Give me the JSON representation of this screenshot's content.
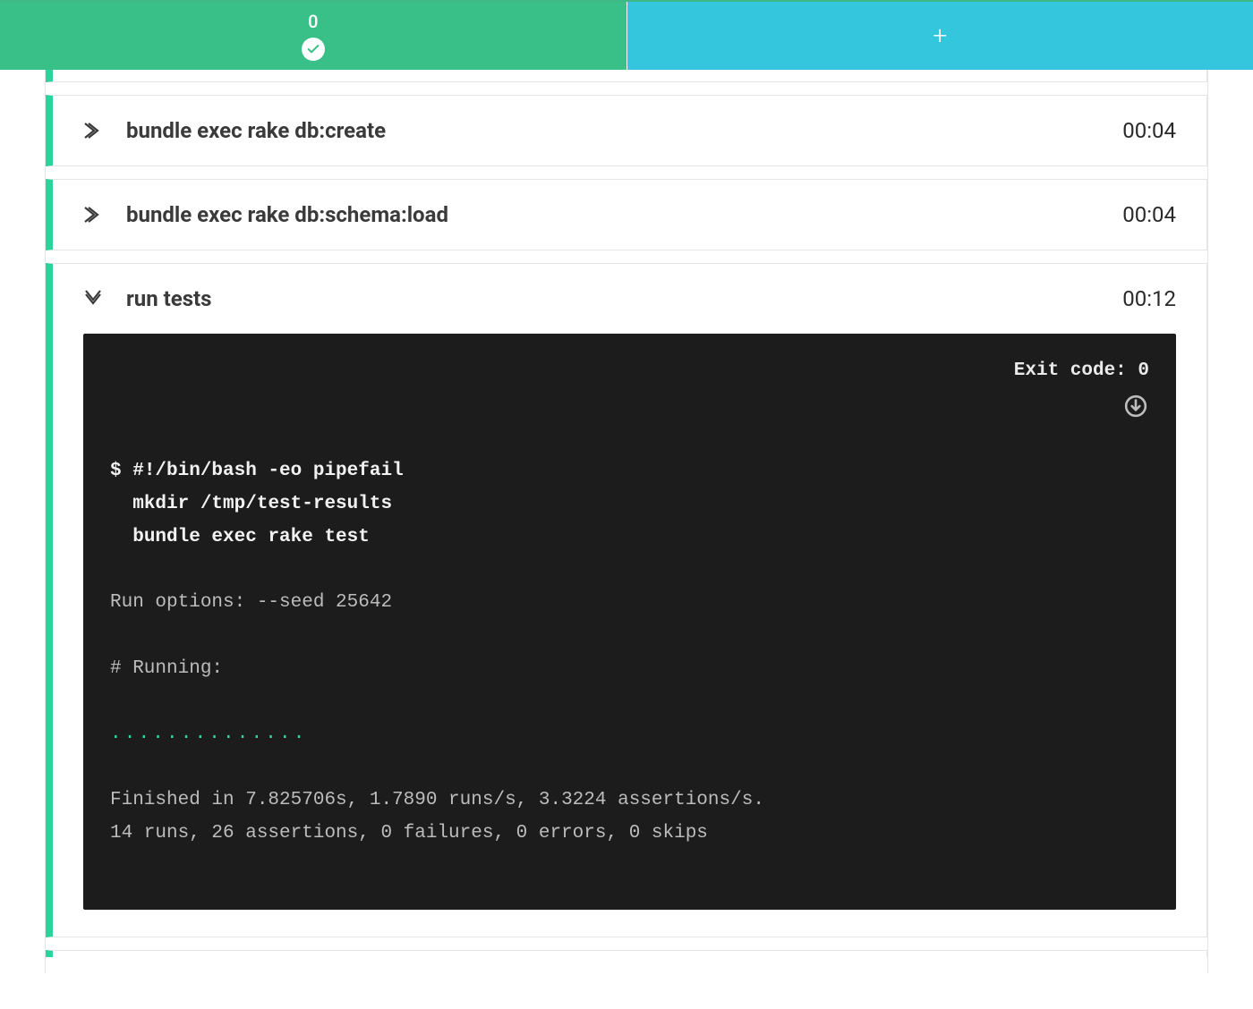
{
  "tabs": {
    "active_label": "0",
    "add_label": "+"
  },
  "steps": [
    {
      "title": "bundle exec rake db:create",
      "duration": "00:04",
      "expanded": false
    },
    {
      "title": "bundle exec rake db:schema:load",
      "duration": "00:04",
      "expanded": false
    },
    {
      "title": "run tests",
      "duration": "00:12",
      "expanded": true
    }
  ],
  "terminal": {
    "exit_code_label": "Exit code: 0",
    "prompt": "$ ",
    "cmd1": "#!/bin/bash -eo pipefail",
    "cmd2": "mkdir /tmp/test-results",
    "cmd3": "bundle exec rake test",
    "out1": "Run options: --seed 25642",
    "out2": "# Running:",
    "dots": "..............",
    "out3": "Finished in 7.825706s, 1.7890 runs/s, 3.3224 assertions/s.",
    "out4": "14 runs, 26 assertions, 0 failures, 0 errors, 0 skips"
  }
}
